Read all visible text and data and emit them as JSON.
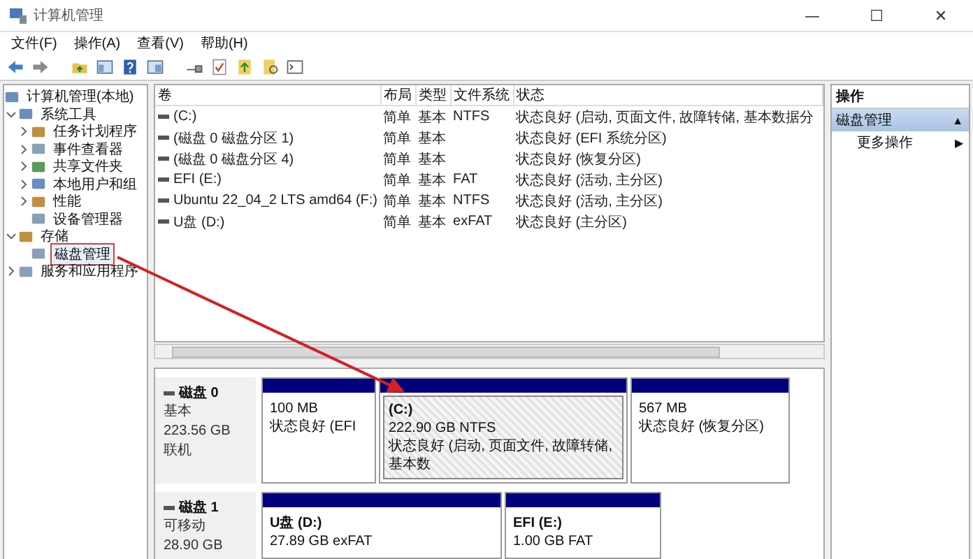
{
  "window": {
    "title": "计算机管理",
    "controls": [
      "—",
      "☐",
      "✕"
    ]
  },
  "menu": [
    "文件(F)",
    "操作(A)",
    "查看(V)",
    "帮助(H)"
  ],
  "tree": {
    "label": "计算机管理(本地)",
    "selected": false,
    "children": [
      {
        "label": "系统工具",
        "selected": false,
        "expanded": true,
        "children": [
          {
            "label": "任务计划程序",
            "selected": false,
            "expanded": false
          },
          {
            "label": "事件查看器",
            "selected": false,
            "expanded": false
          },
          {
            "label": "共享文件夹",
            "selected": false,
            "expanded": false
          },
          {
            "label": "本地用户和组",
            "selected": false,
            "expanded": false
          },
          {
            "label": "性能",
            "selected": false,
            "expanded": false
          },
          {
            "label": "设备管理器",
            "selected": false
          }
        ]
      },
      {
        "label": "存储",
        "selected": false,
        "expanded": true,
        "children": [
          {
            "label": "磁盘管理",
            "selected": true
          }
        ]
      },
      {
        "label": "服务和应用程序",
        "selected": false,
        "expanded": false
      }
    ]
  },
  "volumes": {
    "columns": [
      "卷",
      "布局",
      "类型",
      "文件系统",
      "状态"
    ],
    "rows": [
      [
        "(C:)",
        "简单",
        "基本",
        "NTFS",
        "状态良好 (启动, 页面文件, 故障转储, 基本数据分"
      ],
      [
        "(磁盘 0 磁盘分区 1)",
        "简单",
        "基本",
        "",
        "状态良好 (EFI 系统分区)"
      ],
      [
        "(磁盘 0 磁盘分区 4)",
        "简单",
        "基本",
        "",
        "状态良好 (恢复分区)"
      ],
      [
        "EFI (E:)",
        "简单",
        "基本",
        "FAT",
        "状态良好 (活动, 主分区)"
      ],
      [
        "Ubuntu 22_04_2 LTS amd64 (F:)",
        "简单",
        "基本",
        "NTFS",
        "状态良好 (活动, 主分区)"
      ],
      [
        "U盘 (D:)",
        "简单",
        "基本",
        "exFAT",
        "状态良好 (主分区)"
      ]
    ]
  },
  "disks": [
    {
      "name": "磁盘 0",
      "lines": [
        "基本",
        "223.56 GB",
        "联机"
      ],
      "partitions": [
        {
          "lines": [
            "100 MB",
            "状态良好 (EFI"
          ],
          "selected": false
        },
        {
          "title": "(C:)",
          "lines": [
            "222.90 GB NTFS",
            "状态良好 (启动, 页面文件, 故障转储, 基本数"
          ],
          "selected": true
        },
        {
          "lines": [
            "567 MB",
            "状态良好 (恢复分区)"
          ],
          "selected": false
        }
      ]
    },
    {
      "name": "磁盘 1",
      "lines": [
        "可移动",
        "28.90 GB"
      ],
      "partitions": [
        {
          "title": "U盘  (D:)",
          "lines": [
            "27.89 GB exFAT"
          ],
          "selected": false
        },
        {
          "title": "EFI  (E:)",
          "lines": [
            "1.00 GB FAT"
          ],
          "selected": false
        }
      ]
    }
  ],
  "actions": {
    "header": "操作",
    "section": {
      "label": "磁盘管理",
      "marker": "▲"
    },
    "items": [
      {
        "label": "更多操作",
        "marker": "▶"
      }
    ]
  }
}
